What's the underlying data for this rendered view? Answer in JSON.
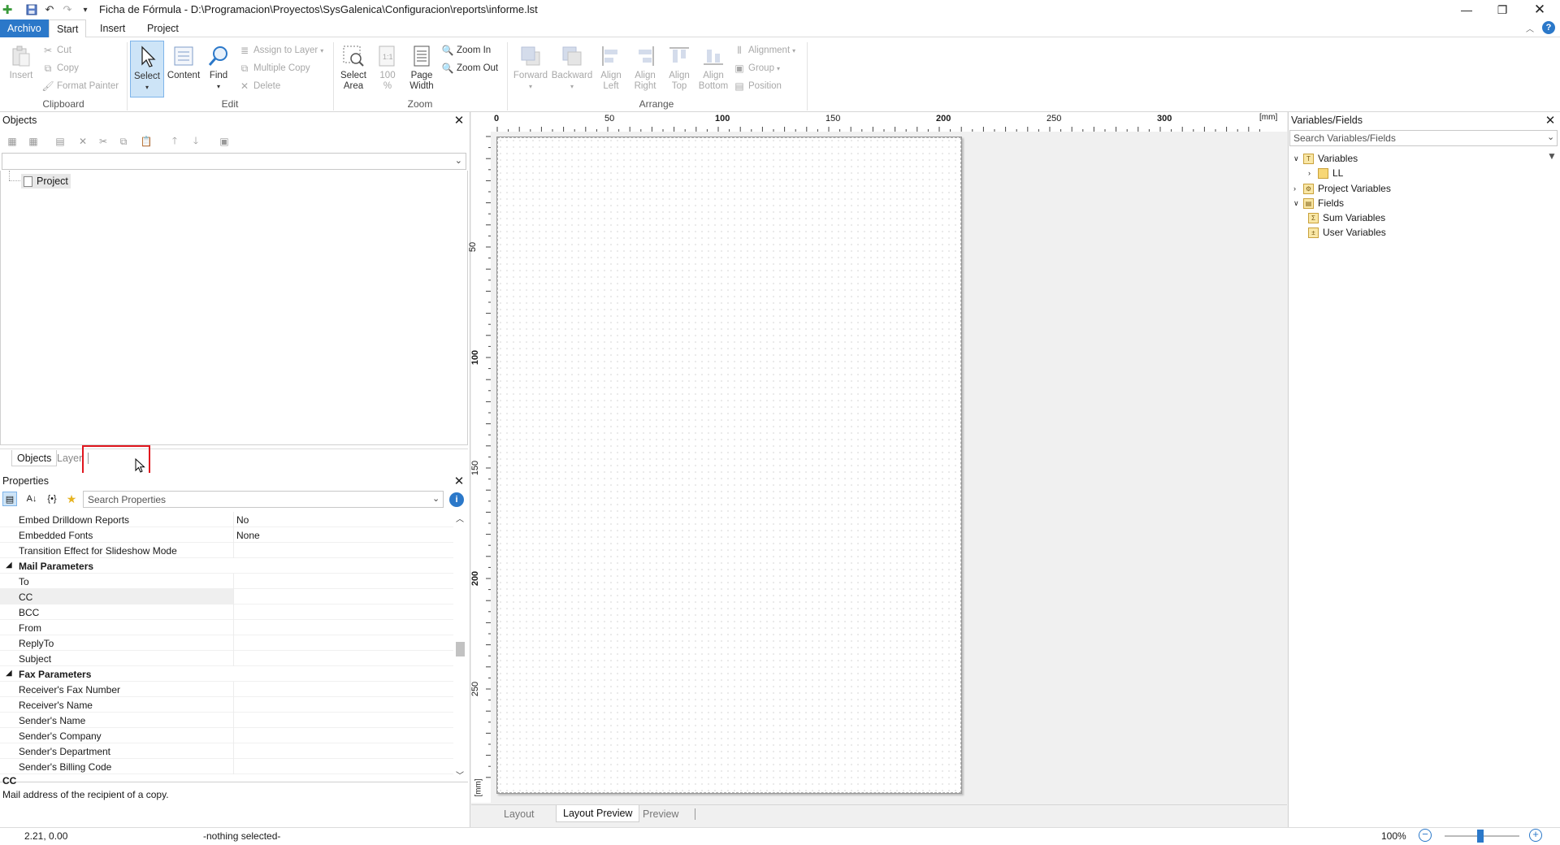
{
  "titlebar": {
    "title": "Ficha de Fórmula - D:\\Programacion\\Proyectos\\SysGalenica\\Configuracion\\reports\\informe.lst"
  },
  "menu": {
    "file": "Archivo",
    "tabs": [
      "Start",
      "Insert",
      "Project"
    ]
  },
  "ribbon": {
    "clipboard": {
      "label": "Clipboard",
      "insert": "Insert",
      "cut": "Cut",
      "copy": "Copy",
      "format_painter": "Format Painter"
    },
    "edit": {
      "label": "Edit",
      "select": "Select",
      "content": "Content",
      "find": "Find",
      "assign_to_layer": "Assign to Layer",
      "multiple_copy": "Multiple Copy",
      "delete": "Delete"
    },
    "zoom": {
      "label": "Zoom",
      "select_area_1": "Select",
      "select_area_2": "Area",
      "hundred_1": "100",
      "hundred_2": "%",
      "page_width_1": "Page",
      "page_width_2": "Width",
      "zoom_in": "Zoom In",
      "zoom_out": "Zoom Out"
    },
    "arrange": {
      "label": "Arrange",
      "forward": "Forward",
      "backward": "Backward",
      "align_left_1": "Align",
      "align_left_2": "Left",
      "align_right_1": "Align",
      "align_right_2": "Right",
      "align_top_1": "Align",
      "align_top_2": "Top",
      "align_bottom_1": "Align",
      "align_bottom_2": "Bottom",
      "alignment": "Alignment",
      "group": "Group",
      "position": "Position"
    }
  },
  "objects_panel": {
    "title": "Objects",
    "tree_root": "Project",
    "tabs": [
      "Objects",
      "Layer"
    ]
  },
  "properties_panel": {
    "title": "Properties",
    "search_placeholder": "Search Properties",
    "rows": [
      {
        "name": "Embed Drilldown Reports",
        "value": "No",
        "type": "prop"
      },
      {
        "name": "Embedded Fonts",
        "value": "None",
        "type": "prop"
      },
      {
        "name": "Transition Effect for Slideshow Mode",
        "value": "",
        "type": "prop"
      },
      {
        "name": "Mail Parameters",
        "value": "",
        "type": "cat"
      },
      {
        "name": "To",
        "value": "",
        "type": "prop"
      },
      {
        "name": "CC",
        "value": "",
        "type": "prop"
      },
      {
        "name": "BCC",
        "value": "",
        "type": "prop"
      },
      {
        "name": "From",
        "value": "",
        "type": "prop"
      },
      {
        "name": "ReplyTo",
        "value": "",
        "type": "prop"
      },
      {
        "name": "Subject",
        "value": "",
        "type": "prop"
      },
      {
        "name": "Fax Parameters",
        "value": "",
        "type": "cat"
      },
      {
        "name": "Receiver's Fax Number",
        "value": "",
        "type": "prop"
      },
      {
        "name": "Receiver's Name",
        "value": "",
        "type": "prop"
      },
      {
        "name": "Sender's Name",
        "value": "",
        "type": "prop"
      },
      {
        "name": "Sender's Company",
        "value": "",
        "type": "prop"
      },
      {
        "name": "Sender's Department",
        "value": "",
        "type": "prop"
      },
      {
        "name": "Sender's Billing Code",
        "value": "",
        "type": "prop"
      }
    ],
    "selected_property": "CC",
    "description_title": "CC",
    "description_text": "Mail address of the recipient of a copy."
  },
  "ruler": {
    "h_labels": [
      "0",
      "50",
      "100",
      "150",
      "200",
      "250",
      "300"
    ],
    "h_unit": "[mm]",
    "v_labels": [
      "50",
      "100",
      "150",
      "200",
      "250"
    ],
    "v_unit": "[mm]"
  },
  "canvas_tabs": [
    "Layout",
    "Layout Preview",
    "Preview"
  ],
  "variables_panel": {
    "title": "Variables/Fields",
    "search_placeholder": "Search Variables/Fields",
    "tree": [
      "Variables",
      "LL",
      "Project Variables",
      "Fields",
      "Sum Variables",
      "User Variables"
    ]
  },
  "statusbar": {
    "coords": "2.21, 0.00",
    "selection": "-nothing selected-",
    "zoom": "100%"
  }
}
